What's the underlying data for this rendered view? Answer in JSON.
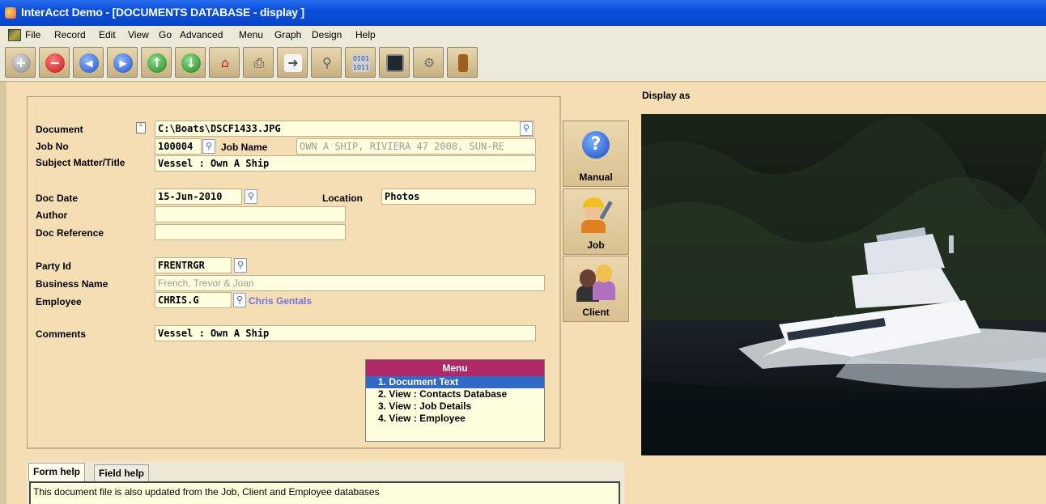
{
  "window": {
    "title": "InterAcct Demo - [DOCUMENTS DATABASE - display ]"
  },
  "menubar": [
    "File",
    "Record",
    "Edit",
    "View",
    "Go",
    "Advanced",
    "Menu",
    "Graph",
    "Design",
    "Help"
  ],
  "toolbar": {
    "buttons": [
      "add-icon",
      "delete-icon",
      "first-record-icon",
      "last-record-icon",
      "previous-record-icon",
      "next-record-icon",
      "home-icon",
      "print-icon",
      "export-icon",
      "search-icon",
      "binary-icon",
      "screen-icon",
      "settings-icon",
      "exit-door-icon"
    ]
  },
  "form": {
    "document": {
      "label": "Document",
      "value": "C:\\Boats\\DSCF1433.JPG"
    },
    "job_no": {
      "label": "Job No",
      "value": "100004"
    },
    "job_name": {
      "label": "Job Name",
      "value": "OWN A SHIP, RIVIERA 47 2008, SUN-RE"
    },
    "subject": {
      "label": "Subject Matter/Title",
      "value": "Vessel : Own A Ship"
    },
    "doc_date": {
      "label": "Doc Date",
      "value": "15-Jun-2010"
    },
    "location": {
      "label": "Location",
      "value": "Photos"
    },
    "author": {
      "label": "Author",
      "value": ""
    },
    "doc_reference": {
      "label": "Doc Reference",
      "value": ""
    },
    "party_id": {
      "label": "Party Id",
      "value": "FRENTRGR"
    },
    "business_name": {
      "label": "Business Name",
      "value": "French, Trevor & Joan"
    },
    "employee": {
      "label": "Employee",
      "value": "CHRIS.G",
      "name": "Chris Gentals"
    },
    "comments": {
      "label": "Comments",
      "value": "Vessel : Own A Ship"
    }
  },
  "side_buttons": {
    "manual": "Manual",
    "job": "Job",
    "client": "Client"
  },
  "menu": {
    "title": "Menu",
    "items": [
      "1. Document Text",
      "2. View : Contacts Database",
      "3. View : Job Details",
      "4. View : Employee"
    ],
    "selected": 0
  },
  "display": {
    "label": "Display as"
  },
  "help": {
    "tabs": [
      "Form help",
      "Field help"
    ],
    "active_tab": 0,
    "text": "This document file is also updated from the Job, Client and Employee databases"
  },
  "colors": {
    "accent": "#b02868",
    "selection": "#316ac5",
    "field_bg": "#ffffe0",
    "panel_bg": "#f5deb3"
  }
}
